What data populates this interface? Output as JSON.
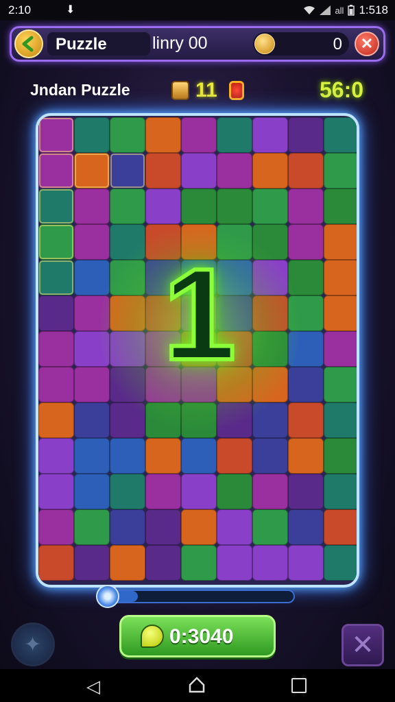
{
  "status_bar": {
    "time_left": "2:10",
    "time_right": "1:518",
    "signal_label": "all"
  },
  "header": {
    "title": "Puzzle",
    "subtitle": "linry 00",
    "coins": "0"
  },
  "info": {
    "puzzle_name": "Jndan Puzzle",
    "pieces_count": "11",
    "timer": "56:0"
  },
  "board": {
    "center_number": "1"
  },
  "slider": {
    "progress_percent": 20
  },
  "footer": {
    "timer_button": "0:3040"
  },
  "colors": {
    "accent_purple": "#9b6cf0",
    "board_border": "#bfe4ff",
    "glow_green": "#8aff3a",
    "button_green": "#4cc43a",
    "counter_yellow": "#e8e83a"
  }
}
